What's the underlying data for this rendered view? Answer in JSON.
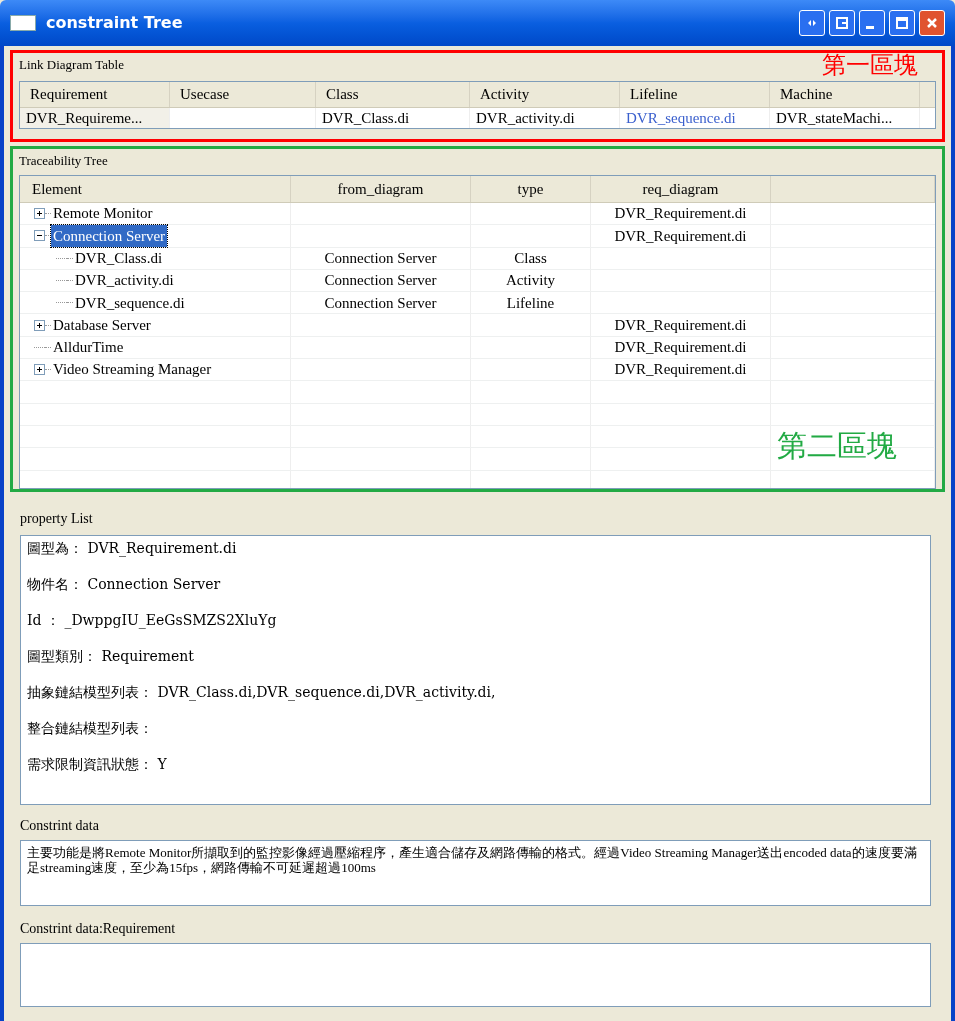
{
  "window": {
    "title": "constraint Tree"
  },
  "link_diagram_table": {
    "label": "Link Diagram Table",
    "columns": [
      "Requirement",
      "Usecase",
      "Class",
      "Activity",
      "Lifeline",
      "Machine"
    ],
    "rows": [
      {
        "cells": [
          {
            "text": "DVR_Requireme..."
          },
          {
            "text": ""
          },
          {
            "text": "DVR_Class.di"
          },
          {
            "text": "DVR_activity.di"
          },
          {
            "text": "DVR_sequence.di",
            "link": true
          },
          {
            "text": "DVR_stateMachi..."
          }
        ]
      }
    ],
    "annotation": {
      "text": "第一區塊",
      "color": "#ff0000"
    }
  },
  "traceability_tree": {
    "label": "Traceability Tree",
    "columns": [
      "Element",
      "from_diagram",
      "type",
      "req_diagram",
      ""
    ],
    "items": [
      {
        "label": "Remote Monitor",
        "req_diagram": "DVR_Requirement.di",
        "expanded": false,
        "selected": false
      },
      {
        "label": "Connection Server",
        "req_diagram": "DVR_Requirement.di",
        "expanded": true,
        "selected": true,
        "children": [
          {
            "label": "DVR_Class.di",
            "from_diagram": "Connection Server",
            "type": "Class",
            "selected": false
          },
          {
            "label": "DVR_activity.di",
            "from_diagram": "Connection Server",
            "type": "Activity",
            "selected": false
          },
          {
            "label": "DVR_sequence.di",
            "from_diagram": "Connection Server",
            "type": "Lifeline",
            "selected": false
          }
        ]
      },
      {
        "label": "Database Server",
        "req_diagram": "DVR_Requirement.di",
        "expanded": false,
        "selected": false
      },
      {
        "label": "AlldurTime",
        "req_diagram": "DVR_Requirement.di",
        "selected": false
      },
      {
        "label": "Video Streaming Manager",
        "req_diagram": "DVR_Requirement.di",
        "expanded": false,
        "selected": false
      }
    ],
    "annotation": {
      "text": "第二區塊",
      "color": "#22aa44"
    }
  },
  "property_list": {
    "label": "property List",
    "lines": [
      "圖型為： DVR_Requirement.di",
      "物件名： Connection Server",
      "Id ： _DwppgIU_EeGsSMZS2XluYg",
      "圖型類別： Requirement",
      "抽象鏈結模型列表： DVR_Class.di,DVR_sequence.di,DVR_activity.di,",
      "整合鏈結模型列表：",
      "需求限制資訊狀態： Y"
    ]
  },
  "constraint_data": {
    "label": "Constrint data",
    "value": "主要功能是將Remote Monitor所擷取到的監控影像經過壓縮程序，產生適合儲存及網路傳輸的格式。經過Video Streaming Manager送出encoded data的速度要滿足streaming速度，至少為15fps，網路傳輸不可延遲超過100ms"
  },
  "constraint_requirement": {
    "label": "Constrint data:Requirement"
  }
}
